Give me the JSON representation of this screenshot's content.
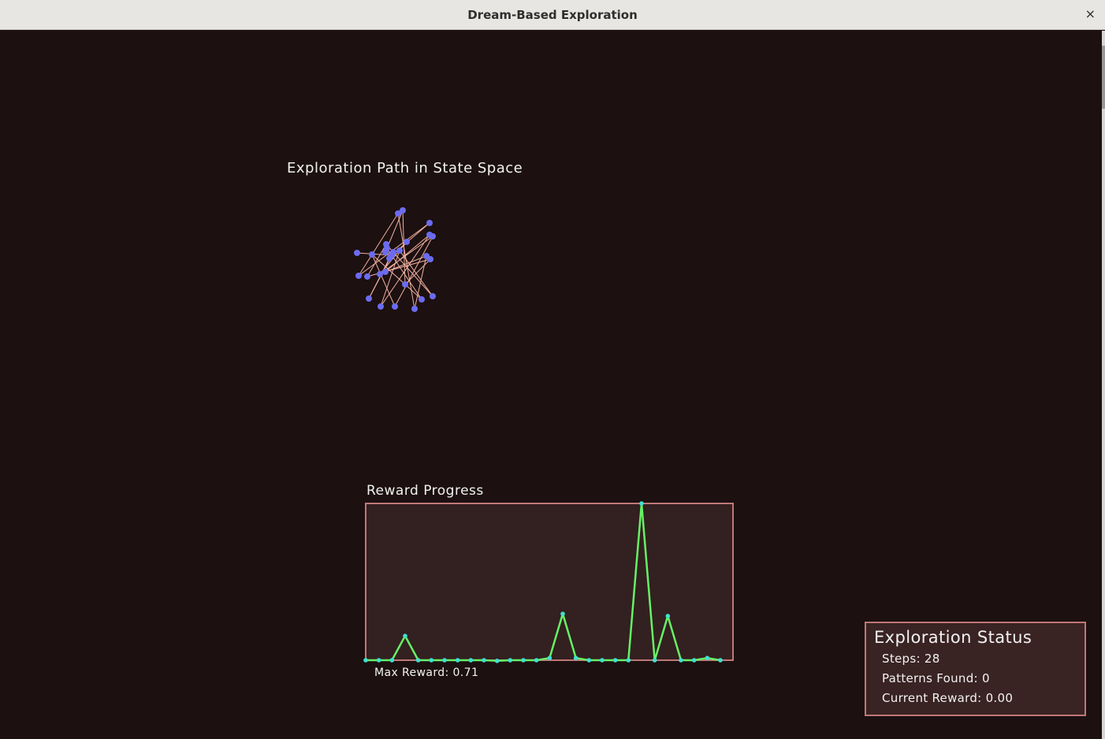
{
  "window": {
    "title": "Dream-Based Exploration",
    "close_glyph": "×"
  },
  "path_plot": {
    "title": "Exploration Path in State Space",
    "node_color": "#6b6bf0",
    "edge_color": "#f0b0a0"
  },
  "chart_data": {
    "type": "line",
    "title": "Reward Progress",
    "x": [
      1,
      2,
      3,
      4,
      5,
      6,
      7,
      8,
      9,
      10,
      11,
      12,
      13,
      14,
      15,
      16,
      17,
      18,
      19,
      20,
      21,
      22,
      23,
      24,
      25,
      26,
      27,
      28
    ],
    "series": [
      {
        "values": [
          0.0,
          0.0,
          0.0,
          0.11,
          0.0,
          0.0,
          0.0,
          0.0,
          0.0,
          0.0,
          -0.003,
          0.0,
          0.0,
          0.0,
          0.01,
          0.21,
          0.01,
          0.0,
          0.0,
          0.0,
          0.0,
          0.71,
          0.0,
          0.2,
          0.0,
          0.0,
          0.01,
          0.0
        ]
      }
    ],
    "ylim": [
      0,
      0.71
    ],
    "line_color": "#66f266",
    "marker_color": "#40e0d0",
    "grid": false,
    "max_reward_label": "Max Reward: 0.71"
  },
  "status": {
    "heading": "Exploration Status",
    "steps": "Steps: 28",
    "patterns": "Patterns Found: 0",
    "current_reward": "Current Reward: 0.00"
  }
}
